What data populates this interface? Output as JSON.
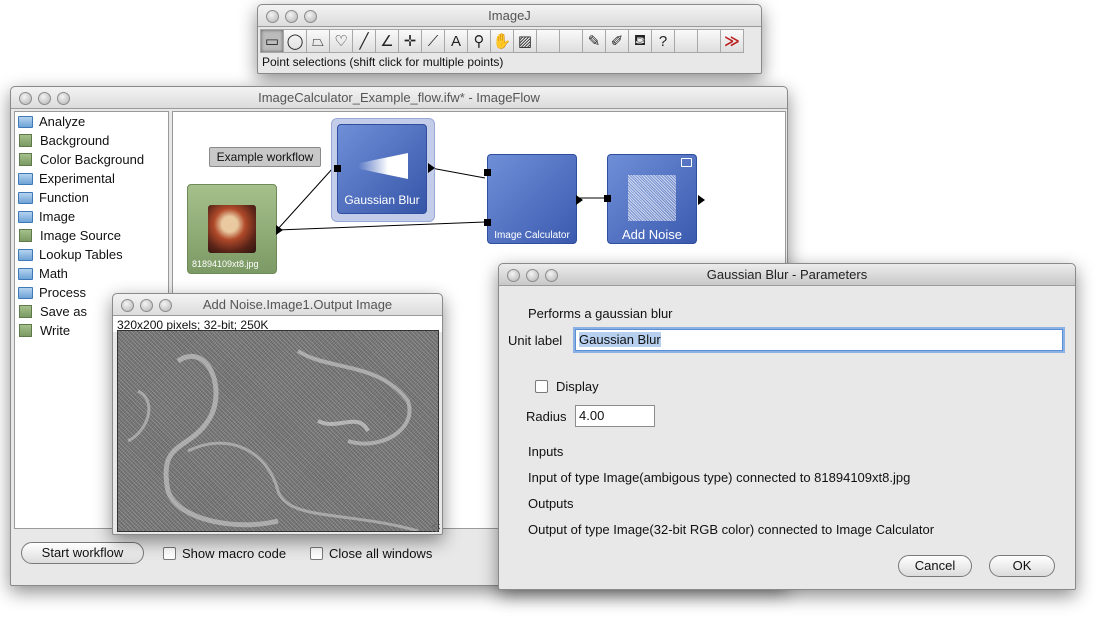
{
  "imagej": {
    "title": "ImageJ",
    "tools": [
      {
        "icon": "rectangle-tool-icon",
        "glyph": "▭"
      },
      {
        "icon": "oval-tool-icon",
        "glyph": "◯"
      },
      {
        "icon": "polygon-tool-icon",
        "glyph": "⏢"
      },
      {
        "icon": "freehand-tool-icon",
        "glyph": "♡"
      },
      {
        "icon": "line-tool-icon",
        "glyph": "╱"
      },
      {
        "icon": "angle-tool-icon",
        "glyph": "∠"
      },
      {
        "icon": "point-tool-icon",
        "glyph": "✛"
      },
      {
        "icon": "wand-tool-icon",
        "glyph": "⟋"
      },
      {
        "icon": "text-tool-icon",
        "glyph": "A"
      },
      {
        "icon": "magnifier-tool-icon",
        "glyph": "⚲"
      },
      {
        "icon": "hand-tool-icon",
        "glyph": "✋"
      },
      {
        "icon": "color-picker-tool-icon",
        "glyph": "▨"
      },
      {
        "icon": "blank-tool-icon",
        "glyph": ""
      },
      {
        "icon": "blank-tool-icon",
        "glyph": ""
      },
      {
        "icon": "pencil-tool-icon",
        "glyph": "✎"
      },
      {
        "icon": "brush-tool-icon",
        "glyph": "✐"
      },
      {
        "icon": "flood-fill-tool-icon",
        "glyph": "⛾"
      },
      {
        "icon": "help-tool-icon",
        "glyph": "?"
      },
      {
        "icon": "blank-tool-icon",
        "glyph": ""
      },
      {
        "icon": "blank-tool-icon",
        "glyph": ""
      },
      {
        "icon": "more-tools-icon",
        "glyph": "≫"
      }
    ],
    "status": "Point selections (shift click for multiple points)"
  },
  "imageflow": {
    "title": "ImageCalculator_Example_flow.ifw* - ImageFlow",
    "sidebar": [
      {
        "label": "Analyze",
        "kind": "folder"
      },
      {
        "label": "Background",
        "kind": "unit"
      },
      {
        "label": "Color Background",
        "kind": "unit"
      },
      {
        "label": "Experimental",
        "kind": "folder"
      },
      {
        "label": "Function",
        "kind": "folder"
      },
      {
        "label": "Image",
        "kind": "folder"
      },
      {
        "label": "Image Source",
        "kind": "unit"
      },
      {
        "label": "Lookup Tables",
        "kind": "folder"
      },
      {
        "label": "Math",
        "kind": "folder"
      },
      {
        "label": "Process",
        "kind": "folder"
      },
      {
        "label": "Save as",
        "kind": "unit"
      },
      {
        "label": "Write",
        "kind": "unit"
      }
    ],
    "workflow_label": "Example workflow",
    "nodes": {
      "source": "81894109xt8.jpg",
      "blur": "Gaussian Blur",
      "calc": "Image Calculator",
      "noise": "Add Noise"
    },
    "start_button": "Start workflow",
    "show_macro": "Show macro code",
    "close_all": "Close all windows"
  },
  "image_window": {
    "title": "Add Noise.Image1.Output Image",
    "info": "320x200 pixels; 32-bit; 250K"
  },
  "dialog": {
    "title": "Gaussian Blur - Parameters",
    "description": "Performs a gaussian blur",
    "unit_label_label": "Unit label",
    "unit_label_value": "Gaussian Blur",
    "display_label": "Display",
    "radius_label": "Radius",
    "radius_value": "4.00",
    "inputs_heading": "Inputs",
    "inputs_text": "Input of type Image(ambigous type) connected to 81894109xt8.jpg",
    "outputs_heading": "Outputs",
    "outputs_text": "Output of type Image(32-bit RGB color) connected to Image Calculator",
    "cancel": "Cancel",
    "ok": "OK"
  }
}
